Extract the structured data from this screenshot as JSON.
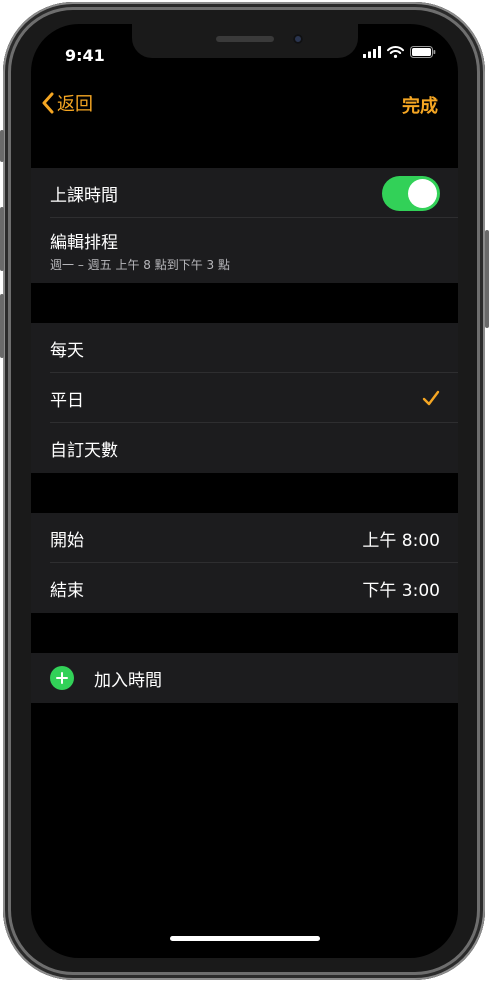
{
  "status": {
    "time": "9:41"
  },
  "nav": {
    "back_label": "返回",
    "done_label": "完成"
  },
  "schedule_group": {
    "toggle_label": "上課時間",
    "toggle_on": true,
    "edit_label": "編輯排程",
    "edit_subtitle": "週一 – 週五 上午 8 點到下午 3 點"
  },
  "days_group": {
    "items": [
      {
        "label": "每天",
        "selected": false
      },
      {
        "label": "平日",
        "selected": true
      },
      {
        "label": "自訂天數",
        "selected": false
      }
    ]
  },
  "time_group": {
    "start_label": "開始",
    "start_value": "上午 8:00",
    "end_label": "結束",
    "end_value": "下午 3:00"
  },
  "add_group": {
    "add_label": "加入時間"
  },
  "colors": {
    "accent": "#f5a623",
    "toggle_on": "#32d158",
    "row_bg": "#1c1c1e",
    "screen_bg": "#000000"
  }
}
